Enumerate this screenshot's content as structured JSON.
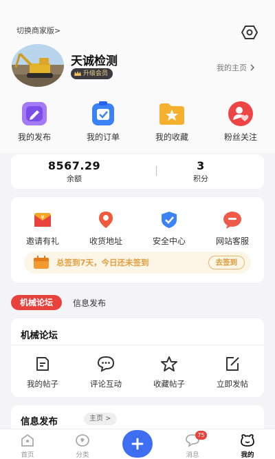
{
  "header": {
    "switch_label": "切换商家版>",
    "shop_name": "天诚检测",
    "member_badge": "升级会员",
    "home_link": "我的主页"
  },
  "quick_actions": [
    {
      "label": "我的发布",
      "icon": "pencil-square-icon",
      "color": "#8b5cf6"
    },
    {
      "label": "我的订单",
      "icon": "clipboard-check-icon",
      "color": "#3b82f6"
    },
    {
      "label": "我的收藏",
      "icon": "star-folder-icon",
      "color": "#f5b02e"
    },
    {
      "label": "粉丝关注",
      "icon": "user-heart-icon",
      "color": "#ef4444"
    }
  ],
  "stats": {
    "balance_value": "8567.29",
    "balance_label": "余额",
    "points_value": "3",
    "points_label": "积分"
  },
  "services": [
    {
      "label": "邀请有礼",
      "icon": "gift-envelope-icon"
    },
    {
      "label": "收货地址",
      "icon": "location-pin-icon"
    },
    {
      "label": "安全中心",
      "icon": "shield-check-icon"
    },
    {
      "label": "网站客服",
      "icon": "chat-bubble-icon"
    }
  ],
  "signin": {
    "text": "总签到7天，今日还未签到",
    "button": "去签到"
  },
  "tabs": {
    "active": "机械论坛",
    "inactive": "信息发布"
  },
  "forum": {
    "title": "机械论坛",
    "items": [
      {
        "label": "我的帖子",
        "icon": "document-icon"
      },
      {
        "label": "评论互动",
        "icon": "comment-icon"
      },
      {
        "label": "收藏帖子",
        "icon": "star-outline-icon"
      },
      {
        "label": "立即发帖",
        "icon": "edit-icon"
      }
    ]
  },
  "info_section": {
    "title": "信息发布",
    "pill": "主页 >"
  },
  "tabbar": {
    "items": [
      "首页",
      "分类",
      "",
      "消息",
      "我的"
    ],
    "message_badge": "75"
  },
  "colors": {
    "accent_red": "#e8423d",
    "plus_blue": "#3d6ff0",
    "signin_orange": "#e0a040"
  }
}
